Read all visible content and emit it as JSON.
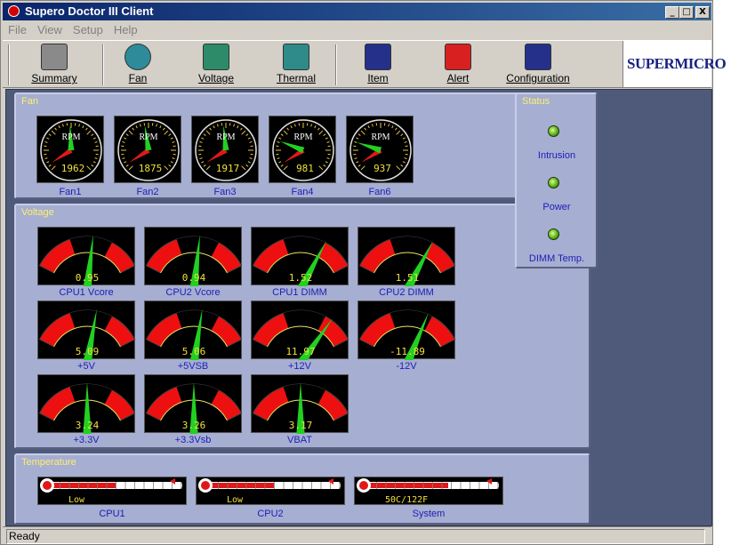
{
  "window": {
    "title": "Supero Doctor III Client",
    "min_label": "_",
    "max_label": "□",
    "close_label": "X"
  },
  "menu": [
    "File",
    "View",
    "Setup",
    "Help"
  ],
  "toolbar": [
    {
      "label": "Summary",
      "icon": "summary-icon",
      "color": "#8a8a8a"
    },
    {
      "label": "Fan",
      "icon": "fan-icon",
      "color": "#2e8b9a"
    },
    {
      "label": "Voltage",
      "icon": "voltage-icon",
      "color": "#2e8b6a"
    },
    {
      "label": "Thermal",
      "icon": "thermal-icon",
      "color": "#2e8b8a"
    },
    {
      "label": "Item",
      "icon": "item-icon",
      "color": "#24308a"
    },
    {
      "label": "Alert",
      "icon": "alert-icon",
      "color": "#d82020"
    },
    {
      "label": "Configuration",
      "icon": "configuration-icon",
      "color": "#24308a"
    }
  ],
  "logo": "SUPERMICRO",
  "fan": {
    "title": "Fan",
    "unit": "RPM",
    "gauges": [
      {
        "label": "Fan1",
        "value": "1962",
        "rpm": 1962
      },
      {
        "label": "Fan2",
        "value": "1875",
        "rpm": 1875
      },
      {
        "label": "Fan3",
        "value": "1917",
        "rpm": 1917
      },
      {
        "label": "Fan4",
        "value": "981",
        "rpm": 981
      },
      {
        "label": "Fan6",
        "value": "937",
        "rpm": 937
      }
    ]
  },
  "voltage": {
    "title": "Voltage",
    "gauges": [
      {
        "label": "CPU1 Vcore",
        "value": "0.95",
        "needle": 0.55
      },
      {
        "label": "CPU2 Vcore",
        "value": "0.94",
        "needle": 0.55
      },
      {
        "label": "CPU1 DIMM",
        "value": "1.52",
        "needle": 0.72
      },
      {
        "label": "CPU2 DIMM",
        "value": "1.51",
        "needle": 0.72
      },
      {
        "label": "+5V",
        "value": "5.09",
        "needle": 0.58
      },
      {
        "label": "+5VSB",
        "value": "5.06",
        "needle": 0.57
      },
      {
        "label": "+12V",
        "value": "11.97",
        "needle": 0.78
      },
      {
        "label": "-12V",
        "value": "-11.89",
        "needle": 0.68
      },
      {
        "label": "+3.3V",
        "value": "3.24",
        "needle": 0.5
      },
      {
        "label": "+3.3Vsb",
        "value": "3.26",
        "needle": 0.5
      },
      {
        "label": "VBAT",
        "value": "3.17",
        "needle": 0.5
      }
    ]
  },
  "temperature": {
    "title": "Temperature",
    "gauges": [
      {
        "label": "CPU1",
        "value": "Low",
        "level": 0.5
      },
      {
        "label": "CPU2",
        "value": "Low",
        "level": 0.5
      },
      {
        "label": "System",
        "value": "50C/122F",
        "level": 0.62
      }
    ]
  },
  "status": {
    "title": "Status",
    "items": [
      {
        "label": "Intrusion",
        "state": "ok"
      },
      {
        "label": "Power",
        "state": "ok"
      },
      {
        "label": "DIMM Temp.",
        "state": "ok"
      }
    ]
  },
  "statusbar": {
    "text": "Ready"
  }
}
